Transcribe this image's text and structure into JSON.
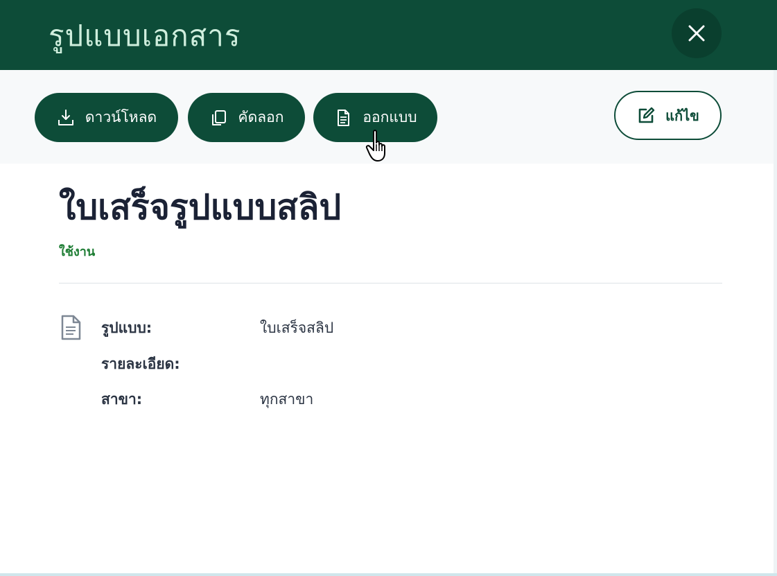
{
  "header": {
    "title": "รูปแบบเอกสาร",
    "close_icon": "close-icon"
  },
  "toolbar": {
    "download_label": "ดาวน์โหลด",
    "copy_label": "คัดลอก",
    "design_label": "ออกแบบ",
    "edit_label": "แก้ไข"
  },
  "document": {
    "title": "ใบเสร็จรูปแบบสลิป",
    "status": "ใช้งาน"
  },
  "details": {
    "format_label": "รูปแบบ:",
    "format_value": "ใบเสร็จสลิป",
    "description_label": "รายละเอียด:",
    "description_value": "",
    "branch_label": "สาขา:",
    "branch_value": "ทุกสาขา"
  },
  "colors": {
    "primary": "#0d4c38",
    "title_text": "#cfeedd",
    "status": "#1e7d34",
    "heading": "#1b2235"
  }
}
